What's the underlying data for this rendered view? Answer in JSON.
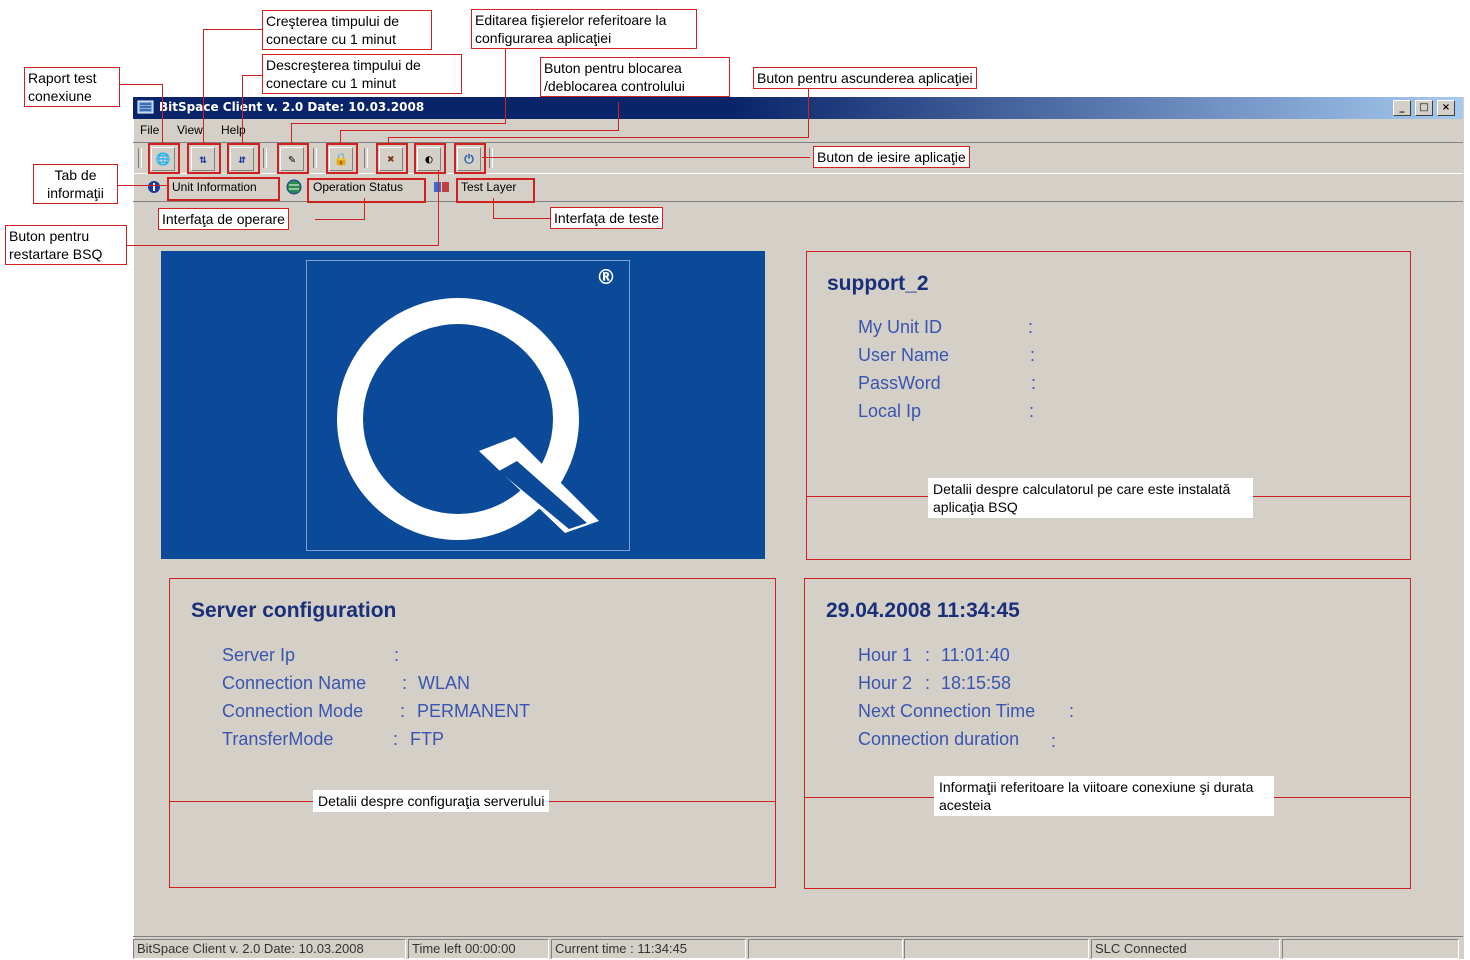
{
  "window": {
    "title": "BitSpace Client v. 2.0  Date: 10.03.2008",
    "controls": {
      "minimize": "_",
      "maximize": "□",
      "close": "×"
    }
  },
  "menu": {
    "items": [
      "File",
      "View",
      "Help"
    ]
  },
  "toolbar": {
    "buttons": [
      {
        "name": "connection-test-report",
        "glyph": "🌐"
      },
      {
        "name": "increase-time",
        "glyph": "⇅"
      },
      {
        "name": "decrease-time",
        "glyph": "⇵"
      },
      {
        "name": "edit-config",
        "glyph": "✎"
      },
      {
        "name": "lock",
        "glyph": "🔒"
      },
      {
        "name": "hide-app",
        "glyph": "✖"
      },
      {
        "name": "restart-bsq",
        "glyph": "◐"
      },
      {
        "name": "exit-app",
        "glyph": "⏻"
      }
    ]
  },
  "tabs": [
    {
      "label": "Unit Information"
    },
    {
      "label": "Operation Status"
    },
    {
      "label": "Test Layer"
    }
  ],
  "logo": {
    "registered": "®"
  },
  "unit_panel": {
    "heading": "support_2",
    "rows": [
      {
        "label": "My Unit ID",
        "sep": ":",
        "value": ""
      },
      {
        "label": "User Name",
        "sep": ":",
        "value": ""
      },
      {
        "label": "PassWord",
        "sep": ":",
        "value": ""
      },
      {
        "label": "Local Ip",
        "sep": ":",
        "value": ""
      }
    ],
    "note": "Detalii despre calculatorul pe care este instalată aplicaţia BSQ"
  },
  "server_panel": {
    "heading": "Server configuration",
    "rows": [
      {
        "label": "Server Ip",
        "sep": ":",
        "value": ""
      },
      {
        "label": "Connection Name",
        "sep": ":",
        "value": "WLAN"
      },
      {
        "label": "Connection Mode",
        "sep": ":",
        "value": "PERMANENT"
      },
      {
        "label": "TransferMode",
        "sep": ":",
        "value": "FTP"
      }
    ],
    "note": "Detalii despre configuraţia serverului"
  },
  "time_panel": {
    "heading": "29.04.2008 11:34:45",
    "rows": [
      {
        "label": "Hour 1",
        "sep": ":",
        "value": "11:01:40"
      },
      {
        "label": "Hour 2",
        "sep": ":",
        "value": "18:15:58"
      },
      {
        "label": "Next Connection Time",
        "sep": ":",
        "value": ""
      },
      {
        "label": "Connection duration",
        "sep": ":",
        "value": ""
      }
    ],
    "note": "Informaţii referitoare la viitoare conexiune şi durata acesteia"
  },
  "callouts": {
    "raport": "Raport test conexiune",
    "cresterea": "Creşterea timpului de conectare cu 1 minut",
    "descresterea": "Descreşterea timpului de conectare cu 1 minut",
    "editarea": "Editarea fişierelor referitoare la configurarea aplicaţiei",
    "blocare": "Buton pentru blocarea /deblocarea controlului",
    "ascundere": "Buton pentru ascunderea aplicaţiei",
    "iesire": "Buton de iesire aplicaţie",
    "tab_info": "Tab de informaţii",
    "interfata_operare": "Interfaţa de operare",
    "interfata_teste": "Interfaţa de teste",
    "restart": "Buton pentru restartare BSQ"
  },
  "statusbar": {
    "app": "BitSpace Client v. 2.0  Date: 10.03.2008",
    "time_left": "Time left   00:00:00",
    "current_time": "Current time : 11:34:45",
    "slc": "SLC Connected"
  },
  "colors": {
    "accent_red": "#d02020",
    "label_blue": "#3a55b0",
    "heading_blue": "#1a2f7a",
    "logo_blue": "#0b4a98",
    "window_gray": "#d4d0c8"
  }
}
